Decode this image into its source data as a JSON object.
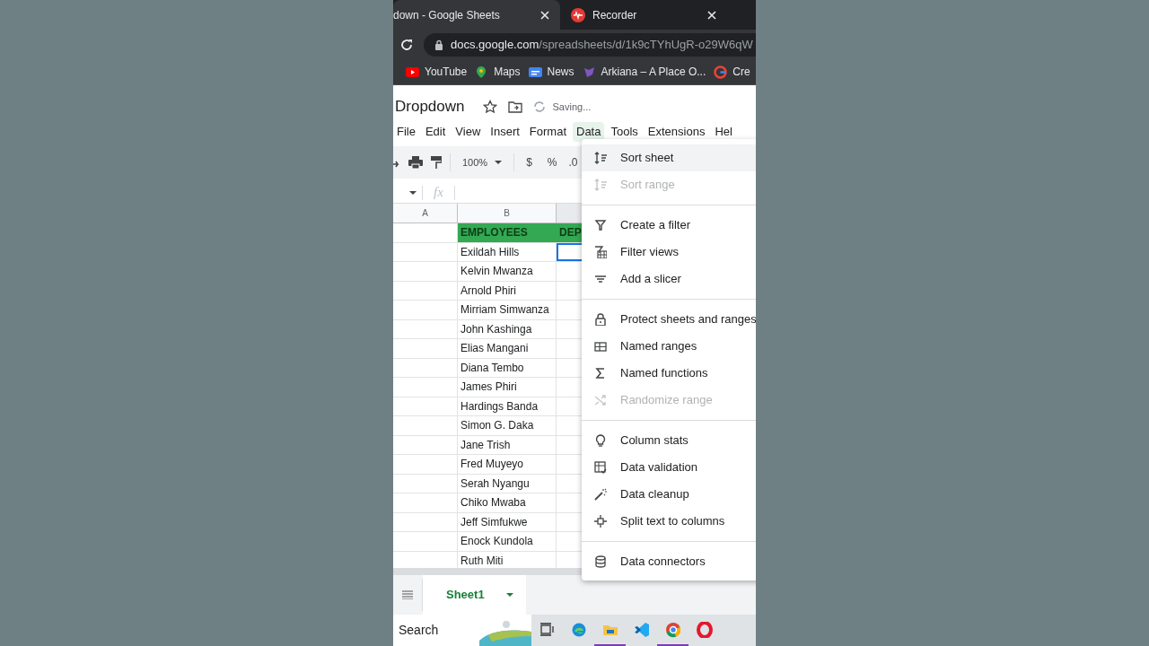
{
  "browser": {
    "tabs": [
      {
        "title": "down - Google Sheets",
        "selected": true
      },
      {
        "title": "Recorder",
        "selected": false
      }
    ],
    "url": {
      "host": "docs.google.com",
      "path": "/spreadsheets/d/1k9cTYhUgR-o29W6qW"
    },
    "bookmarks": [
      {
        "label": "YouTube"
      },
      {
        "label": "Maps"
      },
      {
        "label": "News"
      },
      {
        "label": "Arkiana – A Place O..."
      },
      {
        "label": "Cre"
      }
    ]
  },
  "doc": {
    "title": "Dropdown",
    "status": "Saving..."
  },
  "menubar": [
    {
      "label": "File",
      "selected": false
    },
    {
      "label": "Edit",
      "selected": false
    },
    {
      "label": "View",
      "selected": false
    },
    {
      "label": "Insert",
      "selected": false
    },
    {
      "label": "Format",
      "selected": false
    },
    {
      "label": "Data",
      "selected": true
    },
    {
      "label": "Tools",
      "selected": false
    },
    {
      "label": "Extensions",
      "selected": false
    },
    {
      "label": "Hel",
      "selected": false
    }
  ],
  "toolbar": {
    "zoom": "100%",
    "currency": "$",
    "percent": "%",
    "decimal": ".0"
  },
  "formula_bar": {
    "fx": "fx"
  },
  "sheet": {
    "columns": [
      "A",
      "B"
    ],
    "header": {
      "employees": "EMPLOYEES",
      "column_3": "DEP"
    },
    "rows": [
      "Exildah Hills",
      "Kelvin Mwanza",
      "Arnold Phiri",
      "Mirriam Simwanza",
      "John Kashinga",
      "Elias Mangani",
      "Diana Tembo",
      "James Phiri",
      "Hardings Banda",
      "Simon G. Daka",
      "Jane Trish",
      "Fred Muyeyo",
      "Serah Nyangu",
      "Chiko Mwaba",
      "Jeff Simfukwe",
      "Enock Kundola",
      "Ruth Miti"
    ]
  },
  "data_menu": [
    {
      "kind": "item",
      "label": "Sort sheet",
      "disabled": false,
      "selected": true
    },
    {
      "kind": "item",
      "label": "Sort range",
      "disabled": true,
      "selected": false
    },
    {
      "kind": "separator"
    },
    {
      "kind": "item",
      "label": "Create a filter",
      "disabled": false,
      "selected": false
    },
    {
      "kind": "item",
      "label": "Filter views",
      "disabled": false,
      "selected": false
    },
    {
      "kind": "item",
      "label": "Add a slicer",
      "disabled": false,
      "selected": false
    },
    {
      "kind": "separator"
    },
    {
      "kind": "item",
      "label": "Protect sheets and ranges",
      "disabled": false,
      "selected": false
    },
    {
      "kind": "item",
      "label": "Named ranges",
      "disabled": false,
      "selected": false
    },
    {
      "kind": "item",
      "label": "Named functions",
      "disabled": false,
      "selected": false
    },
    {
      "kind": "item",
      "label": "Randomize range",
      "disabled": true,
      "selected": false
    },
    {
      "kind": "separator"
    },
    {
      "kind": "item",
      "label": "Column stats",
      "disabled": false,
      "selected": false
    },
    {
      "kind": "item",
      "label": "Data validation",
      "disabled": false,
      "selected": false
    },
    {
      "kind": "item",
      "label": "Data cleanup",
      "disabled": false,
      "selected": false
    },
    {
      "kind": "item",
      "label": "Split text to columns",
      "disabled": false,
      "selected": false
    },
    {
      "kind": "separator"
    },
    {
      "kind": "item",
      "label": "Data connectors",
      "disabled": false,
      "selected": false
    }
  ],
  "sheet_tabs": [
    {
      "label": "Sheet1",
      "selected": true
    }
  ],
  "taskbar": {
    "search": "Search",
    "apps": [
      {
        "running": false
      },
      {
        "running": false
      },
      {
        "running": true
      },
      {
        "running": false
      },
      {
        "running": true
      },
      {
        "running": false
      }
    ]
  }
}
